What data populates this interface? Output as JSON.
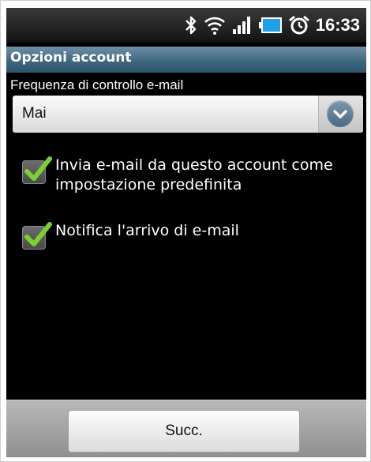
{
  "status_bar": {
    "time": "16:33",
    "icons": [
      "bluetooth-icon",
      "wifi-icon",
      "signal-icon",
      "battery-icon",
      "alarm-icon"
    ]
  },
  "screen": {
    "title": "Opzioni account",
    "section_label": "Frequenza di controllo e-mail",
    "frequency_dropdown": {
      "selected": "Mai"
    },
    "options": [
      {
        "label_line1": "Invia e-mail da questo account come",
        "label_line2": "impostazione predefinita",
        "checked": true
      },
      {
        "label_line1": "Notifica l'arrivo di e-mail",
        "checked": true
      }
    ],
    "next_button_label": "Succ."
  },
  "colors": {
    "title_bar": "#3f6880",
    "check_mark": "#7bd130",
    "background": "#000000"
  }
}
